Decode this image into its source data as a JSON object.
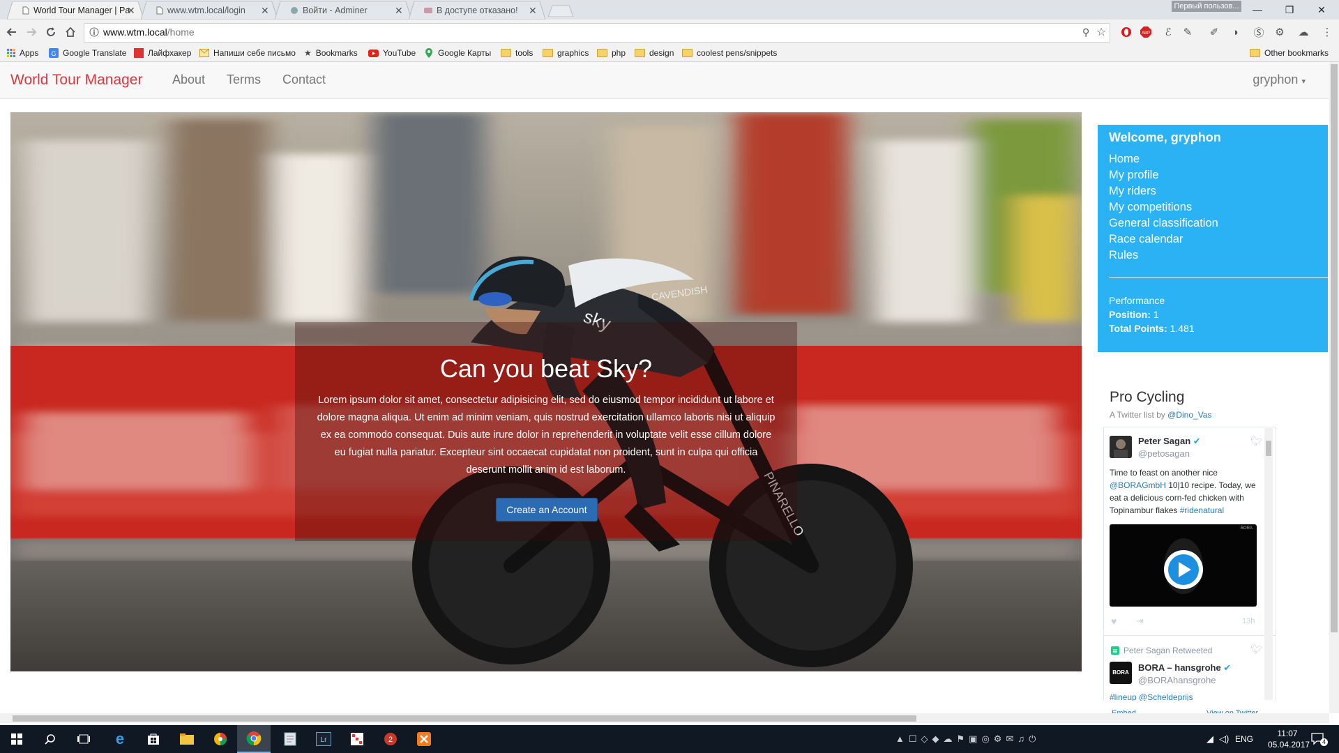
{
  "browser": {
    "tabs": [
      {
        "label": "World Tour Manager | Pa",
        "active": true
      },
      {
        "label": "www.wtm.local/login",
        "active": false
      },
      {
        "label": "Войти - Adminer",
        "active": false
      },
      {
        "label": "В доступе отказано!",
        "active": false
      }
    ],
    "profile": "Первый пользов...",
    "window_controls": {
      "minimize": "—",
      "restore": "❐",
      "close": "✕"
    },
    "url_host": "www.wtm.local",
    "url_path": "/home",
    "bookmarks": [
      "Apps",
      "Google Translate",
      "Лайфхакер",
      "Напиши себе письмо",
      "Bookmarks",
      "YouTube",
      "Google Карты",
      "tools",
      "graphics",
      "php",
      "design",
      "coolest pens/snippets"
    ],
    "other_bookmarks": "Other bookmarks"
  },
  "navbar": {
    "brand": "World Tour Manager",
    "links": [
      "About",
      "Terms",
      "Contact"
    ],
    "user": "gryphon"
  },
  "hero": {
    "title": "Can you beat Sky?",
    "text": "Lorem ipsum dolor sit amet, consectetur adipisicing elit, sed do eiusmod tempor incididunt ut labore et dolore magna aliqua. Ut enim ad minim veniam, quis nostrud exercitation ullamco laboris nisi ut aliquip ex ea commodo consequat. Duis aute irure dolor in reprehenderit in voluptate velit esse cillum dolore eu fugiat nulla pariatur. Excepteur sint occaecat cupidatat non proident, sunt in culpa qui officia deserunt mollit anim id est laborum.",
    "cta": "Create an Account",
    "jersey_text": "CAVENDISH",
    "sponsor": "sky",
    "bike_brand": "PINARELLO"
  },
  "sidebar": {
    "welcome": "Welcome, gryphon",
    "menu": [
      "Home",
      "My profile",
      "My riders",
      "My competitions",
      "General classification",
      "Race calendar",
      "Rules"
    ],
    "performance_label": "Performance",
    "position_label": "Position:",
    "position_value": "1",
    "points_label": "Total Points:",
    "points_value": "1.481"
  },
  "twitter": {
    "title": "Pro Cycling",
    "subtitle_prefix": "A Twitter list by",
    "subtitle_user": "@Dino_Vas",
    "tweet1": {
      "name": "Peter Sagan",
      "handle": "@petosagan",
      "text_a": "Time to feast on another nice",
      "mention": "@BORAGmbH",
      "text_b": "10|10 recipe. Today, we eat a delicious corn-fed chicken with Topinambur flakes",
      "hashtag": "#ridenatural",
      "time": "13h",
      "media_tag": "BORA"
    },
    "retweet_label": "Peter Sagan Retweeted",
    "tweet2": {
      "name": "BORA – hansgrohe",
      "handle": "@BORAhansgrohe",
      "text": "#lineup @Scheldeprijs",
      "avatar_text": "BORA"
    },
    "footer_embed": "Embed",
    "footer_view": "View on Twitter"
  },
  "taskbar": {
    "lang": "ENG",
    "time": "11:07",
    "date": "05.04.2017",
    "notifications": "4",
    "apps": [
      "start",
      "search",
      "task-view",
      "edge",
      "store",
      "explorer",
      "picasa",
      "chrome",
      "notepad",
      "lightroom",
      "calendar",
      "filezilla",
      "xampp"
    ]
  },
  "colors": {
    "brand": "#d9383d",
    "panel": "#2bb2f5",
    "cta": "#2a6bb3",
    "taskbar": "#101823"
  }
}
